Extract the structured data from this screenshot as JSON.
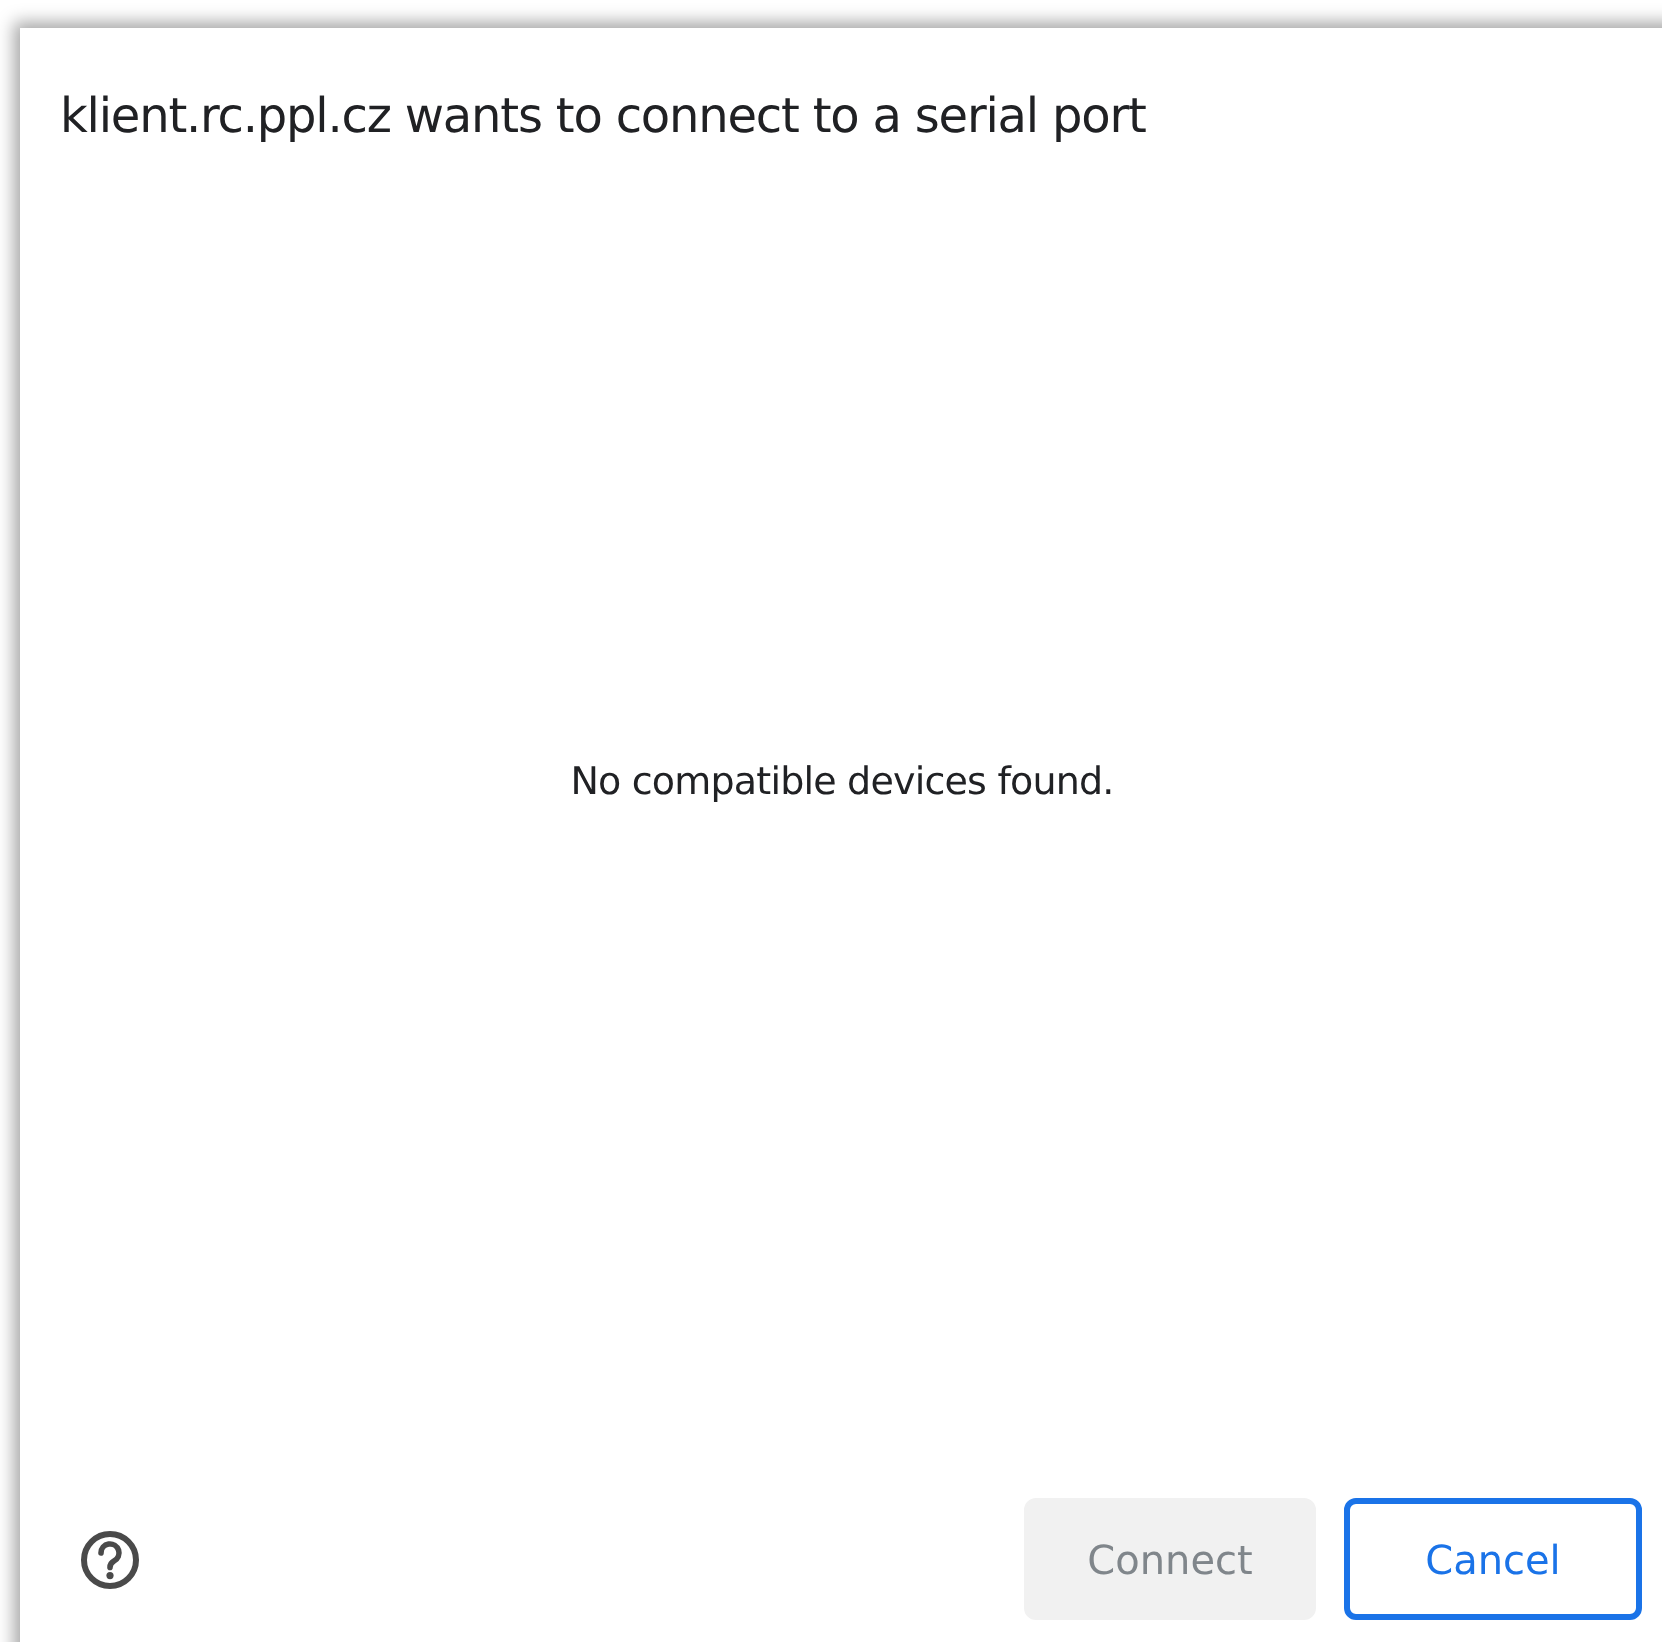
{
  "dialog": {
    "title": "klient.rc.ppl.cz wants to connect to a serial port",
    "message": "No compatible devices found.",
    "buttons": [
      {
        "label": "Connect",
        "disabled": true,
        "focused": false
      },
      {
        "label": "Cancel",
        "disabled": false,
        "focused": true
      }
    ]
  }
}
